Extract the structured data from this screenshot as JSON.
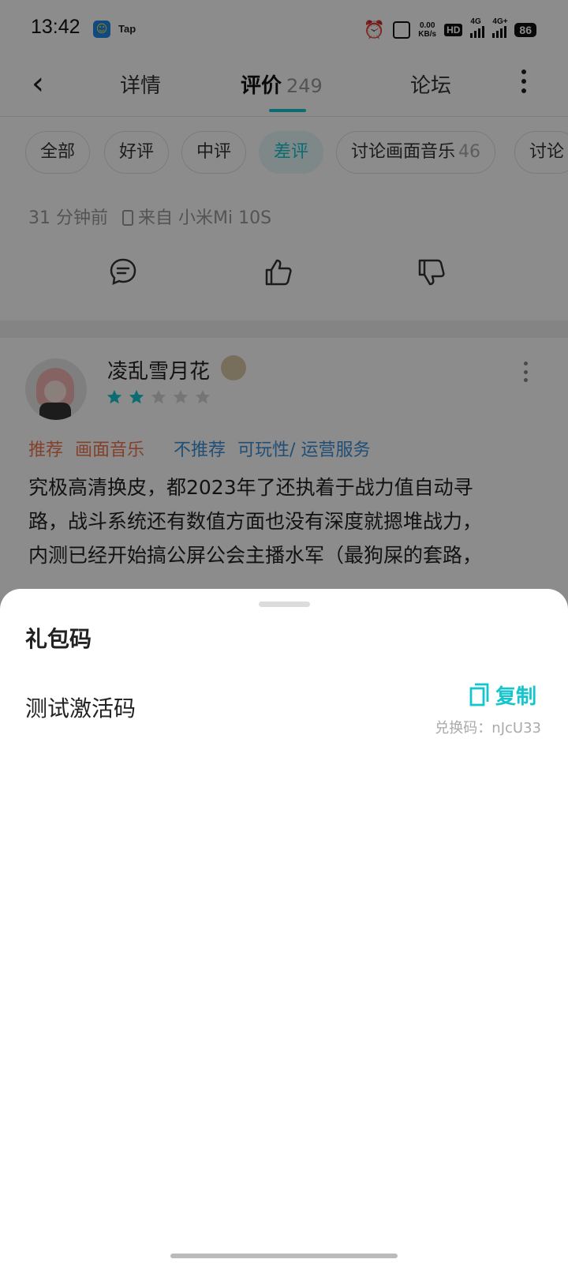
{
  "status_bar": {
    "time": "13:42",
    "app_label": "Tap",
    "speed_value": "0.00",
    "speed_unit": "KB/s",
    "hd_label": "HD",
    "net1": "4G",
    "net2": "4G+",
    "battery": "86"
  },
  "nav": {
    "tabs": [
      {
        "label": "详情"
      },
      {
        "label": "评价",
        "count": "249"
      },
      {
        "label": "论坛"
      }
    ],
    "active_tab": "评价"
  },
  "filters": [
    {
      "label": "全部"
    },
    {
      "label": "好评"
    },
    {
      "label": "中评"
    },
    {
      "label": "差评",
      "active": true
    },
    {
      "label": "讨论画面音乐",
      "count": "46"
    },
    {
      "label": "讨论"
    }
  ],
  "prev_review": {
    "time_ago": "31 分钟前",
    "device": "来自 小米Mi 10S"
  },
  "review": {
    "username": "凌乱雪月花",
    "rating": 2,
    "rating_max": 5,
    "tag_recommend_label": "推荐",
    "tag_recommend_value": "画面音乐",
    "tag_not_recommend_label": "不推荐",
    "tag_not_recommend_value": "可玩性/ 运营服务",
    "text_lines": [
      "究极高清换皮，都2023年了还执着于战力值自动寻",
      "路，战斗系统还有数值方面也没有深度就摁堆战力，",
      "内测已经开始搞公屏公会主播水军（最狗屎的套路，"
    ]
  },
  "sheet": {
    "title": "礼包码",
    "gift_name": "测试激活码",
    "copy_label": "复制",
    "code_label": "兑换码：",
    "code_value": "nJcU33"
  },
  "colors": {
    "accent": "#15c5ce",
    "recommend": "#f0754e",
    "not_recommend": "#3b8fd8",
    "scrim": "rgba(0,0,0,0.45)"
  },
  "icons": [
    "alarm-icon",
    "vibrate-icon",
    "back-icon",
    "more-icon",
    "comment-icon",
    "thumbs-up-icon",
    "thumbs-down-icon",
    "copy-icon",
    "star-icon"
  ]
}
